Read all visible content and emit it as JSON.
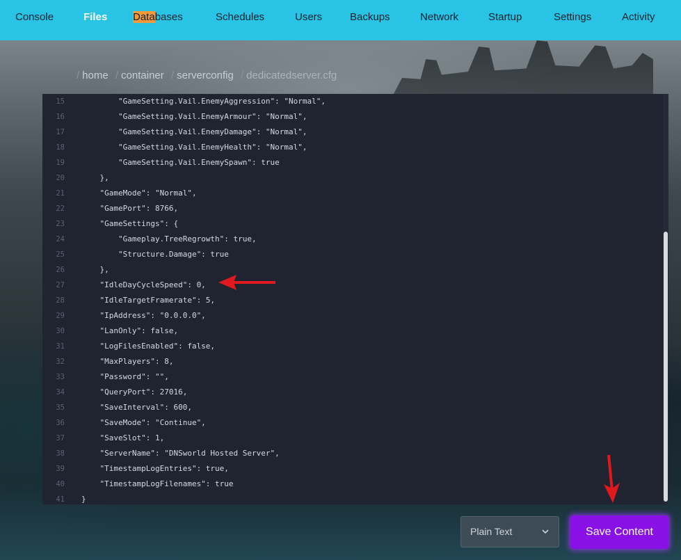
{
  "nav": {
    "items": [
      {
        "id": "console",
        "label": "Console"
      },
      {
        "id": "files",
        "label": "Files",
        "active": true
      },
      {
        "id": "databases",
        "label_highlight": "Data",
        "label_rest": "bases"
      },
      {
        "id": "schedules",
        "label": "Schedules"
      },
      {
        "id": "users",
        "label": "Users"
      },
      {
        "id": "backups",
        "label": "Backups"
      },
      {
        "id": "network",
        "label": "Network"
      },
      {
        "id": "startup",
        "label": "Startup"
      },
      {
        "id": "settings",
        "label": "Settings"
      },
      {
        "id": "activity",
        "label": "Activity"
      }
    ]
  },
  "breadcrumb": {
    "separator": "/",
    "items": [
      "home",
      "container",
      "serverconfig",
      "dedicatedserver.cfg"
    ]
  },
  "editor": {
    "lines": [
      {
        "n": "15",
        "text": "        \"GameSetting.Vail.EnemyAggression\": \"Normal\","
      },
      {
        "n": "16",
        "text": "        \"GameSetting.Vail.EnemyArmour\": \"Normal\","
      },
      {
        "n": "17",
        "text": "        \"GameSetting.Vail.EnemyDamage\": \"Normal\","
      },
      {
        "n": "18",
        "text": "        \"GameSetting.Vail.EnemyHealth\": \"Normal\","
      },
      {
        "n": "19",
        "text": "        \"GameSetting.Vail.EnemySpawn\": true"
      },
      {
        "n": "20",
        "text": "    },"
      },
      {
        "n": "21",
        "text": "    \"GameMode\": \"Normal\","
      },
      {
        "n": "22",
        "text": "    \"GamePort\": 8766,"
      },
      {
        "n": "23",
        "text": "    \"GameSettings\": {"
      },
      {
        "n": "24",
        "text": "        \"Gameplay.TreeRegrowth\": true,"
      },
      {
        "n": "25",
        "text": "        \"Structure.Damage\": true"
      },
      {
        "n": "26",
        "text": "    },"
      },
      {
        "n": "27",
        "text": "    \"IdleDayCycleSpeed\": 0,"
      },
      {
        "n": "28",
        "text": "    \"IdleTargetFramerate\": 5,"
      },
      {
        "n": "29",
        "text": "    \"IpAddress\": \"0.0.0.0\","
      },
      {
        "n": "30",
        "text": "    \"LanOnly\": false,"
      },
      {
        "n": "31",
        "text": "    \"LogFilesEnabled\": false,"
      },
      {
        "n": "32",
        "text": "    \"MaxPlayers\": 8,"
      },
      {
        "n": "33",
        "text": "    \"Password\": \"\","
      },
      {
        "n": "34",
        "text": "    \"QueryPort\": 27016,"
      },
      {
        "n": "35",
        "text": "    \"SaveInterval\": 600,"
      },
      {
        "n": "36",
        "text": "    \"SaveMode\": \"Continue\","
      },
      {
        "n": "37",
        "text": "    \"SaveSlot\": 1,"
      },
      {
        "n": "38",
        "text": "    \"ServerName\": \"DNSworld Hosted Server\","
      },
      {
        "n": "39",
        "text": "    \"TimestampLogEntries\": true,"
      },
      {
        "n": "40",
        "text": "    \"TimestampLogFilenames\": true"
      },
      {
        "n": "41",
        "text": "}"
      }
    ]
  },
  "controls": {
    "syntax_mode": "Plain Text",
    "save_label": "Save Content"
  },
  "colors": {
    "nav_bg": "#29c3e6",
    "editor_bg": "#1f2430",
    "save_button": "#8a11e6",
    "highlight": "#f59a3a",
    "annotation_arrow": "#e0191f"
  },
  "icons": {
    "syntax_chevron": "chevron-down-icon",
    "annotations": [
      "arrow-left-annotation",
      "arrow-down-annotation"
    ]
  }
}
